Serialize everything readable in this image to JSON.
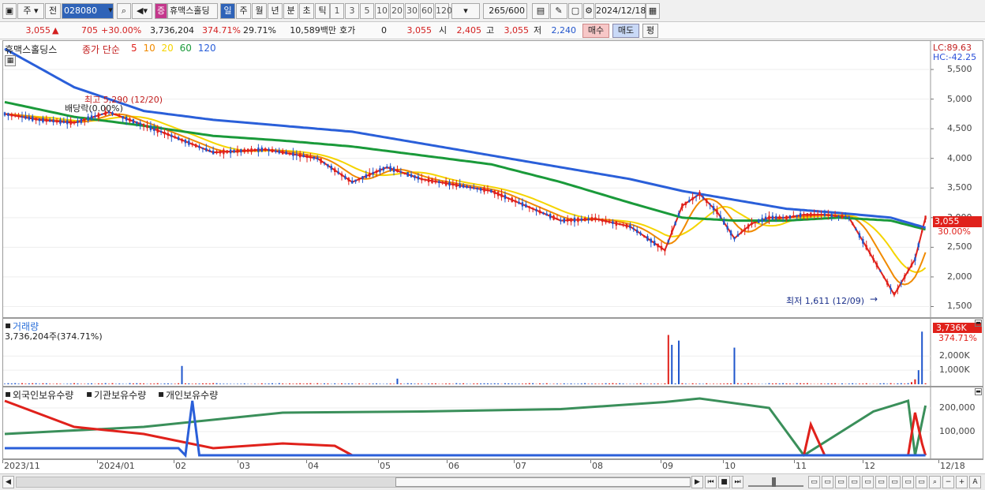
{
  "toolbar": {
    "period_type": "주",
    "prev_label": "전",
    "stock_code": "028080",
    "stock_badge": "증",
    "stock_name": "휴맥스홀딩",
    "periods": [
      "일",
      "주",
      "월",
      "년",
      "분",
      "초",
      "틱"
    ],
    "active_period": "일",
    "intervals": [
      "1",
      "3",
      "5",
      "10",
      "20",
      "30",
      "60",
      "120"
    ],
    "count_value": "265",
    "count_total": "/600",
    "date": "2024/12/18"
  },
  "info": {
    "price": "3,055",
    "change": "705",
    "change_pct": "+30.00%",
    "volume": "3,736,204",
    "volume_ratio": "374.71%",
    "turnover": "29.71%",
    "amount": "10,589백만",
    "hoga_label": "호가",
    "hoga_value": "0",
    "hoga_price": "3,055",
    "open_label": "시",
    "open": "2,405",
    "high_label": "고",
    "high": "3,055",
    "low_label": "저",
    "low": "2,240",
    "buy_label": "매수",
    "sell_label": "매도",
    "eval_label": "평"
  },
  "price_panel": {
    "legend_name": "휴맥스홀딩스",
    "legend_type": "종가 단순",
    "ma_labels": [
      "5",
      "10",
      "20",
      "60",
      "120"
    ],
    "ma_colors": [
      "#e0211b",
      "#f08a00",
      "#f5d400",
      "#1a9a3a",
      "#2a5fd9"
    ],
    "lc_label": "LC:89.63",
    "hc_label": "HC:-42.25",
    "y_ticks": [
      "5,500",
      "5,000",
      "4,500",
      "4,000",
      "3,500",
      "3,000",
      "2,500",
      "2,000",
      "1,500"
    ],
    "current_price_tag": "3,055",
    "current_pct_tag": "30.00%",
    "high_annotation": "최고 5,290 (12/20)",
    "dividend_annotation": "배당락(0.00%)",
    "low_annotation": "최저 1,611 (12/09)"
  },
  "volume_panel": {
    "title": "거래량",
    "current": "3,736,204주(374.71%)",
    "tag_value": "3,736K",
    "tag_pct": "374.71%",
    "y_ticks": [
      "2,000K",
      "1,000K"
    ]
  },
  "holding_panel": {
    "legend": [
      "외국인보유수량",
      "기관보유수량",
      "개인보유수량"
    ],
    "legend_colors": [
      "#e0211b",
      "#2a5fd9",
      "#3a8f5a"
    ],
    "y_ticks": [
      "200,000",
      "100,000"
    ]
  },
  "time_axis": {
    "labels": [
      "2023/11",
      "2024/01",
      "02",
      "03",
      "04",
      "05",
      "06",
      "07",
      "08",
      "09",
      "10",
      "11",
      "12",
      "12/18"
    ]
  },
  "chart_data": {
    "type": "line",
    "title": "휴맥스홀딩스",
    "ylim": [
      1400,
      5900
    ],
    "price_series": [
      {
        "name": "5",
        "x": [
          0,
          10,
          20,
          30,
          45,
          60,
          75,
          90,
          100,
          110,
          120,
          130,
          140,
          150,
          160,
          170,
          180,
          190,
          195,
          200,
          205,
          210,
          215,
          220,
          225,
          230,
          236,
          243,
          250,
          256,
          262,
          265
        ],
        "y": [
          4750,
          4650,
          4600,
          4780,
          4450,
          4100,
          4150,
          4000,
          3600,
          3850,
          3650,
          3550,
          3450,
          3200,
          2950,
          2980,
          2850,
          2450,
          3200,
          3400,
          3100,
          2650,
          2900,
          3000,
          3000,
          3050,
          3050,
          3000,
          2300,
          1700,
          2300,
          3000
        ]
      },
      {
        "name": "60",
        "x": [
          0,
          20,
          40,
          60,
          80,
          100,
          120,
          140,
          160,
          180,
          195,
          210,
          225,
          240,
          255,
          265
        ],
        "y": [
          4950,
          4700,
          4550,
          4380,
          4300,
          4200,
          4050,
          3900,
          3600,
          3250,
          3000,
          2950,
          2950,
          3000,
          2950,
          2800
        ]
      },
      {
        "name": "120",
        "x": [
          0,
          20,
          40,
          60,
          80,
          100,
          120,
          140,
          160,
          180,
          195,
          210,
          225,
          240,
          255,
          265
        ],
        "y": [
          5850,
          5200,
          4800,
          4650,
          4550,
          4450,
          4250,
          4050,
          3850,
          3650,
          3450,
          3300,
          3150,
          3080,
          3000,
          2830
        ]
      }
    ],
    "volume_K": {
      "x": [
        51,
        113,
        191,
        192,
        194,
        210,
        261,
        262,
        263,
        264
      ],
      "values": [
        1300,
        400,
        3500,
        2800,
        3100,
        2600,
        150,
        350,
        1000,
        3736
      ]
    },
    "holding": {
      "series": [
        {
          "name": "개인보유수량",
          "x": [
            0,
            40,
            80,
            120,
            160,
            190,
            200,
            220,
            230,
            250,
            260,
            262,
            265
          ],
          "values": [
            90000,
            120000,
            180000,
            185000,
            195000,
            225000,
            240000,
            200000,
            0,
            185000,
            230000,
            0,
            210000
          ]
        },
        {
          "name": "외국인보유수량",
          "x": [
            0,
            20,
            40,
            60,
            80,
            95,
            100,
            230,
            232,
            236,
            240,
            260,
            262,
            264,
            265
          ],
          "values": [
            230000,
            120000,
            90000,
            30000,
            50000,
            40000,
            0,
            0,
            130000,
            0,
            0,
            0,
            180000,
            50000,
            0
          ]
        },
        {
          "name": "기관보유수량",
          "x": [
            0,
            50,
            52,
            54,
            56,
            58,
            60,
            265
          ],
          "values": [
            30000,
            30000,
            0,
            230000,
            0,
            0,
            0,
            0
          ]
        }
      ]
    }
  }
}
